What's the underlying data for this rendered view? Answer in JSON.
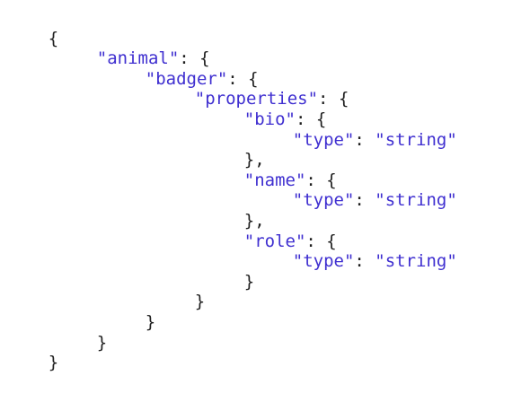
{
  "code": {
    "root_open": "{",
    "root_close": "}",
    "animal_key": "\"animal\"",
    "badger_key": "\"badger\"",
    "properties_key": "\"properties\"",
    "bio_key": "\"bio\"",
    "name_key": "\"name\"",
    "role_key": "\"role\"",
    "type_key": "\"type\"",
    "string_value": "\"string\"",
    "colon": ": ",
    "open_brace": "{",
    "close_brace": "}",
    "close_brace_comma": "},"
  },
  "colors": {
    "key_color": "#3f2fd0",
    "text_color": "#1f1f1f",
    "background": "#ffffff"
  }
}
